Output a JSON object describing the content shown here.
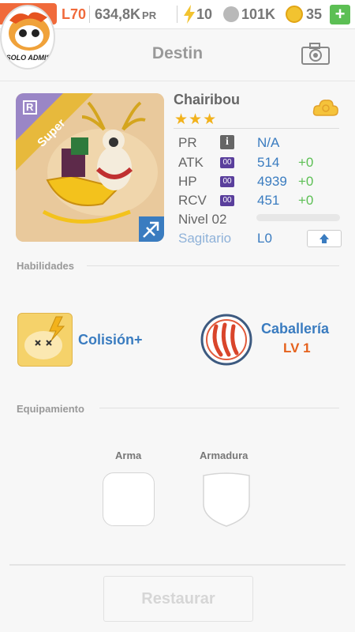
{
  "topbar": {
    "level": "L70",
    "power": "634,8K",
    "power_unit": "PR",
    "energy": "10",
    "paws": "101K",
    "coins": "35",
    "plus_label": "+"
  },
  "avatar": {
    "label": "SOLO ADMIS"
  },
  "header": {
    "title": "Destin"
  },
  "pet": {
    "name": "Chairibou",
    "stars": "★★★",
    "rarity": "Super",
    "rank_badge": "R",
    "stats": {
      "pr_label": "PR",
      "pr_value": "N/A",
      "atk_label": "ATK",
      "atk_value": "514",
      "atk_plus": "+0",
      "hp_label": "HP",
      "hp_value": "4939",
      "hp_plus": "+0",
      "rcv_label": "RCV",
      "rcv_value": "451",
      "rcv_plus": "+0",
      "badge": "00",
      "info": "i",
      "level_label": "Nivel 02",
      "exp_progress": 0,
      "zodiac_label": "Sagitario",
      "zodiac_level": "L0"
    }
  },
  "skills": {
    "title": "Habilidades",
    "active_name": "Colisión+",
    "leader_name": "Caballería",
    "leader_level": "LV 1"
  },
  "equipment": {
    "title": "Equipamiento",
    "weapon": "Arma",
    "armor": "Armadura"
  },
  "actions": {
    "restore": "Restaurar"
  },
  "colors": {
    "accent_orange": "#f06a3b",
    "link_blue": "#3a7cc0",
    "plus_green": "#5cbf54",
    "gold": "#f2b21c"
  },
  "icons": [
    "bolt-icon",
    "paw-icon",
    "coin-icon",
    "camera-icon",
    "cloud-icon",
    "sagittarius-icon",
    "claw-icon",
    "arrow-up-icon"
  ]
}
